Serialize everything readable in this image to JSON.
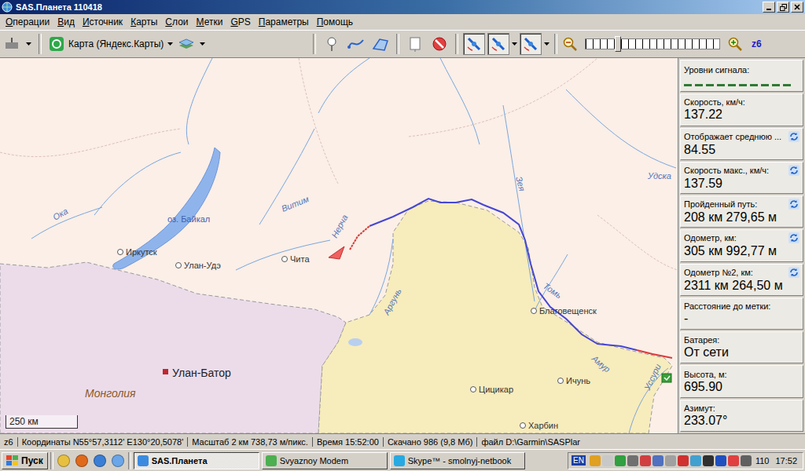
{
  "window": {
    "title": "SAS.Планета 110418"
  },
  "menu": [
    "Операции",
    "Вид",
    "Источник",
    "Карты",
    "Слои",
    "Метки",
    "GPS",
    "Параметры",
    "Помощь"
  ],
  "toolbar": {
    "map_source": "Карта (Яндекс.Карты)",
    "zoom_label": "z6",
    "zoom_level": 0.24,
    "tool_buttons": [
      {
        "pressed": false
      },
      {
        "pressed": false
      },
      {
        "pressed": false
      },
      {
        "pressed": false
      },
      {
        "pressed": false
      },
      {
        "pressed": true
      },
      {
        "pressed": true
      },
      {
        "pressed": true
      }
    ]
  },
  "map": {
    "scale": "250 км",
    "labels": [
      {
        "text": "Ока",
        "kind": "river"
      },
      {
        "text": "оз. Байкал",
        "kind": "lake"
      },
      {
        "text": "Витим",
        "kind": "river"
      },
      {
        "text": "Нерча",
        "kind": "river"
      },
      {
        "text": "Иркутск",
        "kind": "city"
      },
      {
        "text": "Улан-Удэ",
        "kind": "city"
      },
      {
        "text": "Чита",
        "kind": "city"
      },
      {
        "text": "Аргунь",
        "kind": "river"
      },
      {
        "text": "Зея",
        "kind": "river"
      },
      {
        "text": "Томь",
        "kind": "river"
      },
      {
        "text": "Благовещенск",
        "kind": "city"
      },
      {
        "text": "Амур",
        "kind": "river"
      },
      {
        "text": "Уссури",
        "kind": "river"
      },
      {
        "text": "Удска",
        "kind": "river"
      },
      {
        "text": "Улан-Батор",
        "kind": "capital"
      },
      {
        "text": "Монголия",
        "kind": "country"
      },
      {
        "text": "Цицикар",
        "kind": "city"
      },
      {
        "text": "Ичунь",
        "kind": "city"
      },
      {
        "text": "Харбин",
        "kind": "city"
      }
    ]
  },
  "sensors": [
    {
      "label": "Уровни сигнала:",
      "kind": "signal",
      "levels": [
        0,
        0,
        0,
        0,
        0,
        0,
        0,
        0,
        0,
        0
      ],
      "refresh": false
    },
    {
      "label": "Скорость, км/ч:",
      "kind": "value",
      "value": "137.22",
      "refresh": false
    },
    {
      "label": "Отображает среднюю ...",
      "kind": "value",
      "value": "84.55",
      "refresh": true
    },
    {
      "label": "Скорость макс., км/ч:",
      "kind": "value",
      "value": "137.59",
      "refresh": true
    },
    {
      "label": "Пройденный путь:",
      "kind": "value",
      "value": "208 км 279,65 м",
      "refresh": true
    },
    {
      "label": "Одометр, км:",
      "kind": "value",
      "value": "305 км 992,77 м",
      "refresh": true
    },
    {
      "label": "Одометр №2, км:",
      "kind": "value",
      "value": "2311 км 264,50 м",
      "refresh": true
    },
    {
      "label": "Расстояние до метки:",
      "kind": "value",
      "value": "-",
      "refresh": false
    },
    {
      "label": "Батарея:",
      "kind": "value",
      "value": "От сети",
      "refresh": false
    },
    {
      "label": "Высота, м:",
      "kind": "value",
      "value": "695.90",
      "refresh": false
    },
    {
      "label": "Азимут:",
      "kind": "value",
      "value": "233.07°",
      "refresh": false
    }
  ],
  "status_bar": [
    "z6",
    "Координаты N55°57,3112' E130°20,5078'",
    "Масштаб 2 км 738,73 м/пикс.",
    "Время 15:52:00",
    "Скачано 986 (9,8 Мб)",
    "файл D:\\Garmin\\SASPlar"
  ],
  "taskbar": {
    "start": "Пуск",
    "tasks": [
      {
        "label": "SAS.Планета",
        "selected": true
      },
      {
        "label": "Svyaznoy Modem",
        "selected": false
      },
      {
        "label": "Skype™ - smolnyj-netbook",
        "selected": false
      }
    ],
    "language": "EN",
    "tray_number": "110",
    "clock": "17:52"
  }
}
